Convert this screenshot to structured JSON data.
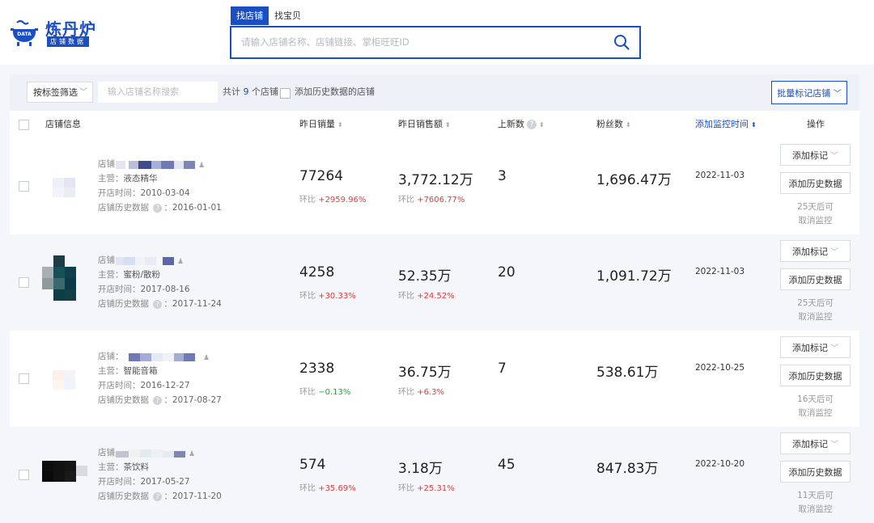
{
  "logo": {
    "title": "炼丹炉",
    "subtitle": "店铺数据",
    "badge": "DATA"
  },
  "search": {
    "tabs": [
      "找店铺",
      "找宝贝"
    ],
    "placeholder": "请输入店铺名称、店铺链接、掌柜旺旺ID"
  },
  "filter": {
    "tag_filter": "按标签筛选",
    "name_placeholder": "输入店铺名称搜索",
    "total_prefix": "共计",
    "total_count": "9",
    "total_suffix": "个店铺",
    "history_label": "添加历史数据的店铺",
    "batch_button": "批量标记店铺"
  },
  "columns": {
    "shop": "店铺信息",
    "sales": "昨日销量",
    "revenue": "昨日销售额",
    "new_items": "上新数",
    "fans": "粉丝数",
    "added": "添加监控时间",
    "ops": "操作"
  },
  "labels": {
    "shop": "店铺",
    "main": "主营：",
    "opened": "开店时间：",
    "history": "店铺历史数据",
    "mark_button": "添加标记",
    "history_button": "添加历史数据",
    "mom": "环比"
  },
  "rows": [
    {
      "name_sep": "",
      "category": "液态精华",
      "opened": "2010-03-04",
      "history_date": "2016-01-01",
      "sales": "77264",
      "sales_mom": "+2959.96%",
      "revenue": "3,772.12万",
      "revenue_mom": "+7606.77%",
      "new_items": "3",
      "fans": "1,696.47万",
      "added": "2022-11-03",
      "cancel_1": "25天后可",
      "cancel_2": "取消监控"
    },
    {
      "name_sep": "",
      "category": "蜜粉/散粉",
      "opened": "2017-08-16",
      "history_date": "2017-11-24",
      "sales": "4258",
      "sales_mom": "+30.33%",
      "revenue": "52.35万",
      "revenue_mom": "+24.52%",
      "new_items": "20",
      "fans": "1,091.72万",
      "added": "2022-11-03",
      "cancel_1": "25天后可",
      "cancel_2": "取消监控"
    },
    {
      "name_sep": "：",
      "category": "智能音箱",
      "opened": "2016-12-27",
      "history_date": "2017-08-27",
      "sales": "2338",
      "sales_mom": "−0.13%",
      "revenue": "36.75万",
      "revenue_mom": "+6.3%",
      "new_items": "7",
      "fans": "538.61万",
      "added": "2022-10-25",
      "cancel_1": "16天后可",
      "cancel_2": "取消监控"
    },
    {
      "name_sep": "",
      "category": "茶饮料",
      "opened": "2017-05-27",
      "history_date": "2017-11-20",
      "sales": "574",
      "sales_mom": "+35.69%",
      "revenue": "3.18万",
      "revenue_mom": "+25.31%",
      "new_items": "45",
      "fans": "847.83万",
      "added": "2022-10-20",
      "cancel_1": "11天后可",
      "cancel_2": "取消监控"
    }
  ]
}
